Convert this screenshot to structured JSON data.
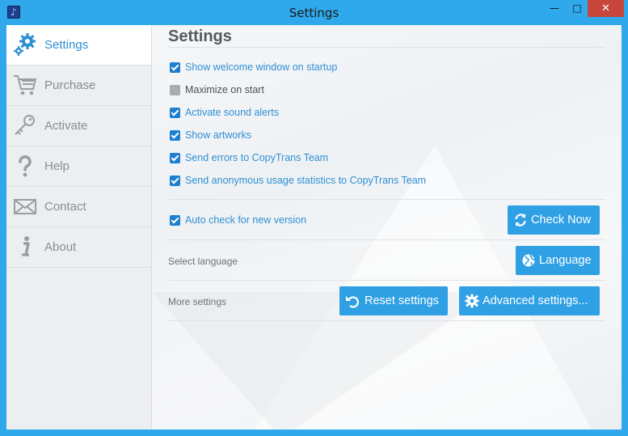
{
  "window": {
    "title": "Settings",
    "minimize": "—",
    "maximize": "□",
    "close": "✕"
  },
  "sidebar": {
    "items": [
      {
        "label": "Settings",
        "icon": "gears-icon",
        "active": true
      },
      {
        "label": "Purchase",
        "icon": "cart-icon",
        "active": false
      },
      {
        "label": "Activate",
        "icon": "key-icon",
        "active": false
      },
      {
        "label": "Help",
        "icon": "question-icon",
        "active": false
      },
      {
        "label": "Contact",
        "icon": "envelope-icon",
        "active": false
      },
      {
        "label": "About",
        "icon": "info-icon",
        "active": false
      }
    ]
  },
  "main": {
    "title": "Settings",
    "options": [
      {
        "label": "Show welcome window on startup",
        "checked": true
      },
      {
        "label": "Maximize on start",
        "checked": false
      },
      {
        "label": "Activate sound alerts",
        "checked": true
      },
      {
        "label": "Show artworks",
        "checked": true
      },
      {
        "label": "Send errors to CopyTrans Team",
        "checked": true
      },
      {
        "label": "Send anonymous usage statistics to CopyTrans Team",
        "checked": true
      }
    ],
    "update": {
      "label": "Auto check for new version",
      "checked": true,
      "button": "Check Now"
    },
    "language": {
      "label": "Select language",
      "button": "Language"
    },
    "more": {
      "label": "More settings",
      "reset_button": "Reset settings",
      "advanced_button": "Advanced settings..."
    }
  },
  "colors": {
    "accent": "#2fa0e4",
    "titlebar": "#2fa8ec",
    "close": "#c7463c",
    "link": "#2f8fd4"
  }
}
